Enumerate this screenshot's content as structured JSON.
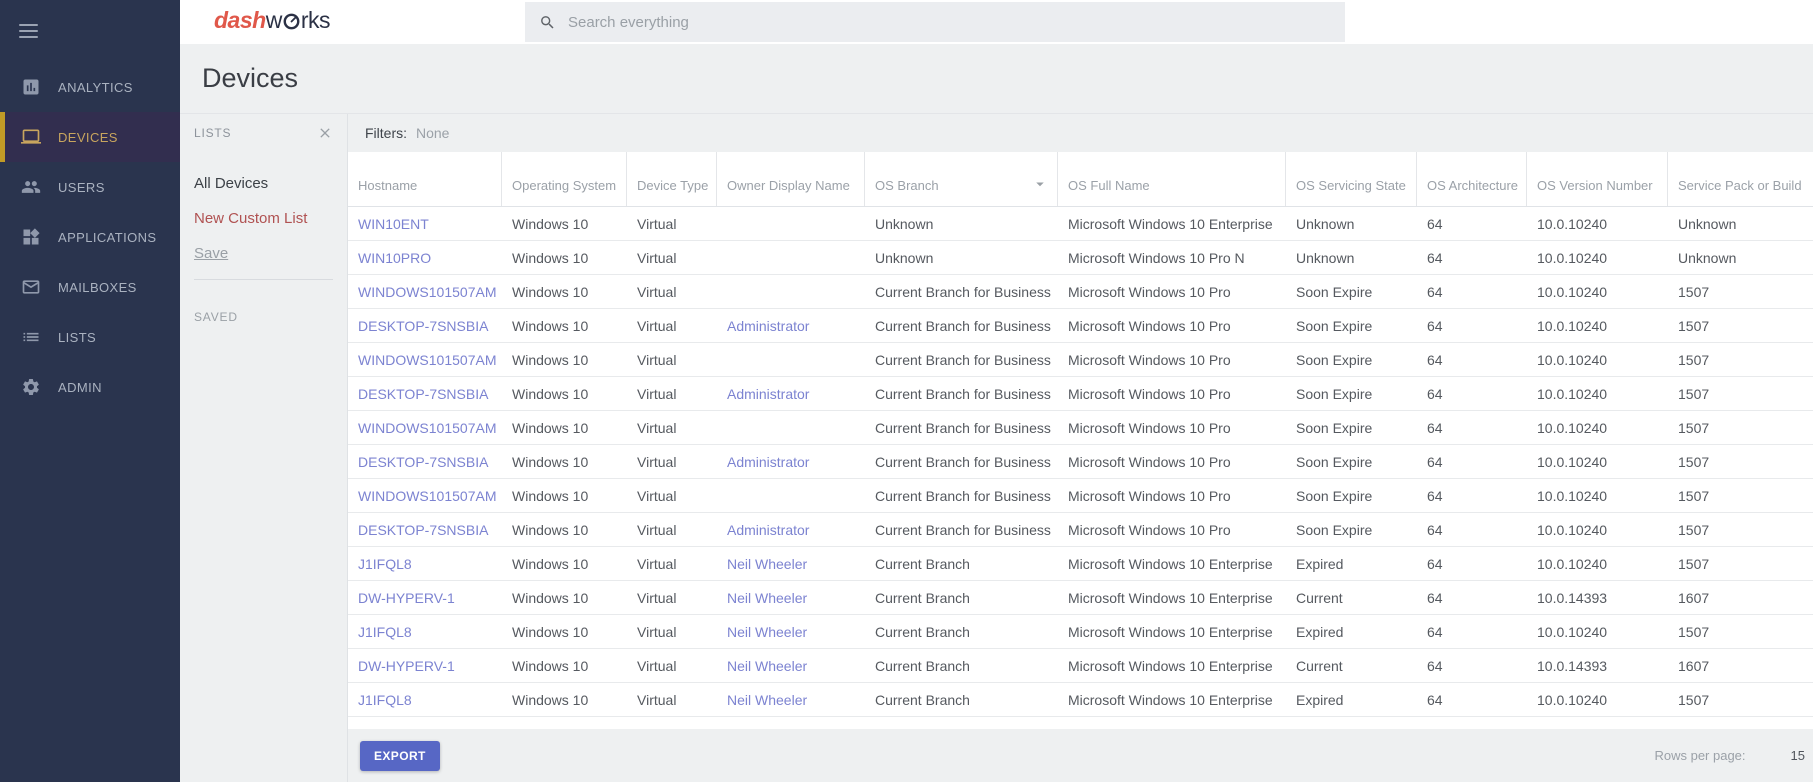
{
  "colors": {
    "sidebar_bg": "#2a344e",
    "active_gold": "#c19b26",
    "active_item": "#c8a55e",
    "link": "#7c83d1",
    "export_button": "#5767c5",
    "logo_red": "#e0584a",
    "logo_dark": "#2b3145"
  },
  "header": {
    "logo": {
      "part1": "dash",
      "part2": "w",
      "part3": "rks"
    },
    "search": {
      "placeholder": "Search everything"
    }
  },
  "sidebar": {
    "items": [
      {
        "label": "ANALYTICS",
        "icon": "analytics",
        "active": false
      },
      {
        "label": "DEVICES",
        "icon": "laptop",
        "active": true
      },
      {
        "label": "USERS",
        "icon": "people",
        "active": false
      },
      {
        "label": "APPLICATIONS",
        "icon": "widgets",
        "active": false
      },
      {
        "label": "MAILBOXES",
        "icon": "envelope",
        "active": false
      },
      {
        "label": "LISTS",
        "icon": "list",
        "active": false
      },
      {
        "label": "ADMIN",
        "icon": "gear",
        "active": false
      }
    ]
  },
  "page": {
    "title": "Devices"
  },
  "lists_panel": {
    "title": "LISTS",
    "items": [
      {
        "label": "All Devices",
        "style": "dark"
      },
      {
        "label": "New Custom List",
        "style": "red"
      },
      {
        "label": "Save",
        "style": "underline"
      }
    ],
    "saved_header": "SAVED"
  },
  "filters": {
    "label": "Filters:",
    "value": "None"
  },
  "table": {
    "columns": [
      "Hostname",
      "Operating System",
      "Device Type",
      "Owner Display Name",
      "OS Branch",
      "OS Full Name",
      "OS Servicing State",
      "OS Architecture",
      "OS Version Number",
      "Service Pack or Build"
    ],
    "sorted_column": "OS Branch",
    "rows": [
      {
        "hostname": "WIN10ENT",
        "os": "Windows 10",
        "device_type": "Virtual",
        "owner": "",
        "os_branch": "Unknown",
        "os_full_name": "Microsoft Windows 10 Enterprise",
        "os_servicing_state": "Unknown",
        "os_architecture": "64",
        "os_version": "10.0.10240",
        "service_pack": "Unknown"
      },
      {
        "hostname": "WIN10PRO",
        "os": "Windows 10",
        "device_type": "Virtual",
        "owner": "",
        "os_branch": "Unknown",
        "os_full_name": "Microsoft Windows 10 Pro N",
        "os_servicing_state": "Unknown",
        "os_architecture": "64",
        "os_version": "10.0.10240",
        "service_pack": "Unknown"
      },
      {
        "hostname": "WINDOWS101507AM",
        "os": "Windows 10",
        "device_type": "Virtual",
        "owner": "",
        "os_branch": "Current Branch for Business",
        "os_full_name": "Microsoft Windows 10 Pro",
        "os_servicing_state": "Soon Expire",
        "os_architecture": "64",
        "os_version": "10.0.10240",
        "service_pack": "1507"
      },
      {
        "hostname": "DESKTOP-7SNSBIA",
        "os": "Windows 10",
        "device_type": "Virtual",
        "owner": "Administrator",
        "os_branch": "Current Branch for Business",
        "os_full_name": "Microsoft Windows 10 Pro",
        "os_servicing_state": "Soon Expire",
        "os_architecture": "64",
        "os_version": "10.0.10240",
        "service_pack": "1507"
      },
      {
        "hostname": "WINDOWS101507AM",
        "os": "Windows 10",
        "device_type": "Virtual",
        "owner": "",
        "os_branch": "Current Branch for Business",
        "os_full_name": "Microsoft Windows 10 Pro",
        "os_servicing_state": "Soon Expire",
        "os_architecture": "64",
        "os_version": "10.0.10240",
        "service_pack": "1507"
      },
      {
        "hostname": "DESKTOP-7SNSBIA",
        "os": "Windows 10",
        "device_type": "Virtual",
        "owner": "Administrator",
        "os_branch": "Current Branch for Business",
        "os_full_name": "Microsoft Windows 10 Pro",
        "os_servicing_state": "Soon Expire",
        "os_architecture": "64",
        "os_version": "10.0.10240",
        "service_pack": "1507"
      },
      {
        "hostname": "WINDOWS101507AM",
        "os": "Windows 10",
        "device_type": "Virtual",
        "owner": "",
        "os_branch": "Current Branch for Business",
        "os_full_name": "Microsoft Windows 10 Pro",
        "os_servicing_state": "Soon Expire",
        "os_architecture": "64",
        "os_version": "10.0.10240",
        "service_pack": "1507"
      },
      {
        "hostname": "DESKTOP-7SNSBIA",
        "os": "Windows 10",
        "device_type": "Virtual",
        "owner": "Administrator",
        "os_branch": "Current Branch for Business",
        "os_full_name": "Microsoft Windows 10 Pro",
        "os_servicing_state": "Soon Expire",
        "os_architecture": "64",
        "os_version": "10.0.10240",
        "service_pack": "1507"
      },
      {
        "hostname": "WINDOWS101507AM",
        "os": "Windows 10",
        "device_type": "Virtual",
        "owner": "",
        "os_branch": "Current Branch for Business",
        "os_full_name": "Microsoft Windows 10 Pro",
        "os_servicing_state": "Soon Expire",
        "os_architecture": "64",
        "os_version": "10.0.10240",
        "service_pack": "1507"
      },
      {
        "hostname": "DESKTOP-7SNSBIA",
        "os": "Windows 10",
        "device_type": "Virtual",
        "owner": "Administrator",
        "os_branch": "Current Branch for Business",
        "os_full_name": "Microsoft Windows 10 Pro",
        "os_servicing_state": "Soon Expire",
        "os_architecture": "64",
        "os_version": "10.0.10240",
        "service_pack": "1507"
      },
      {
        "hostname": "J1IFQL8",
        "os": "Windows 10",
        "device_type": "Virtual",
        "owner": "Neil Wheeler",
        "os_branch": "Current Branch",
        "os_full_name": "Microsoft Windows 10 Enterprise",
        "os_servicing_state": "Expired",
        "os_architecture": "64",
        "os_version": "10.0.10240",
        "service_pack": "1507"
      },
      {
        "hostname": "DW-HYPERV-1",
        "os": "Windows 10",
        "device_type": "Virtual",
        "owner": "Neil Wheeler",
        "os_branch": "Current Branch",
        "os_full_name": "Microsoft Windows 10 Enterprise",
        "os_servicing_state": "Current",
        "os_architecture": "64",
        "os_version": "10.0.14393",
        "service_pack": "1607"
      },
      {
        "hostname": "J1IFQL8",
        "os": "Windows 10",
        "device_type": "Virtual",
        "owner": "Neil Wheeler",
        "os_branch": "Current Branch",
        "os_full_name": "Microsoft Windows 10 Enterprise",
        "os_servicing_state": "Expired",
        "os_architecture": "64",
        "os_version": "10.0.10240",
        "service_pack": "1507"
      },
      {
        "hostname": "DW-HYPERV-1",
        "os": "Windows 10",
        "device_type": "Virtual",
        "owner": "Neil Wheeler",
        "os_branch": "Current Branch",
        "os_full_name": "Microsoft Windows 10 Enterprise",
        "os_servicing_state": "Current",
        "os_architecture": "64",
        "os_version": "10.0.14393",
        "service_pack": "1607"
      },
      {
        "hostname": "J1IFQL8",
        "os": "Windows 10",
        "device_type": "Virtual",
        "owner": "Neil Wheeler",
        "os_branch": "Current Branch",
        "os_full_name": "Microsoft Windows 10 Enterprise",
        "os_servicing_state": "Expired",
        "os_architecture": "64",
        "os_version": "10.0.10240",
        "service_pack": "1507"
      }
    ]
  },
  "footer": {
    "export_label": "EXPORT",
    "rows_per_page_label": "Rows per page:",
    "rows_per_page_value": "15"
  }
}
